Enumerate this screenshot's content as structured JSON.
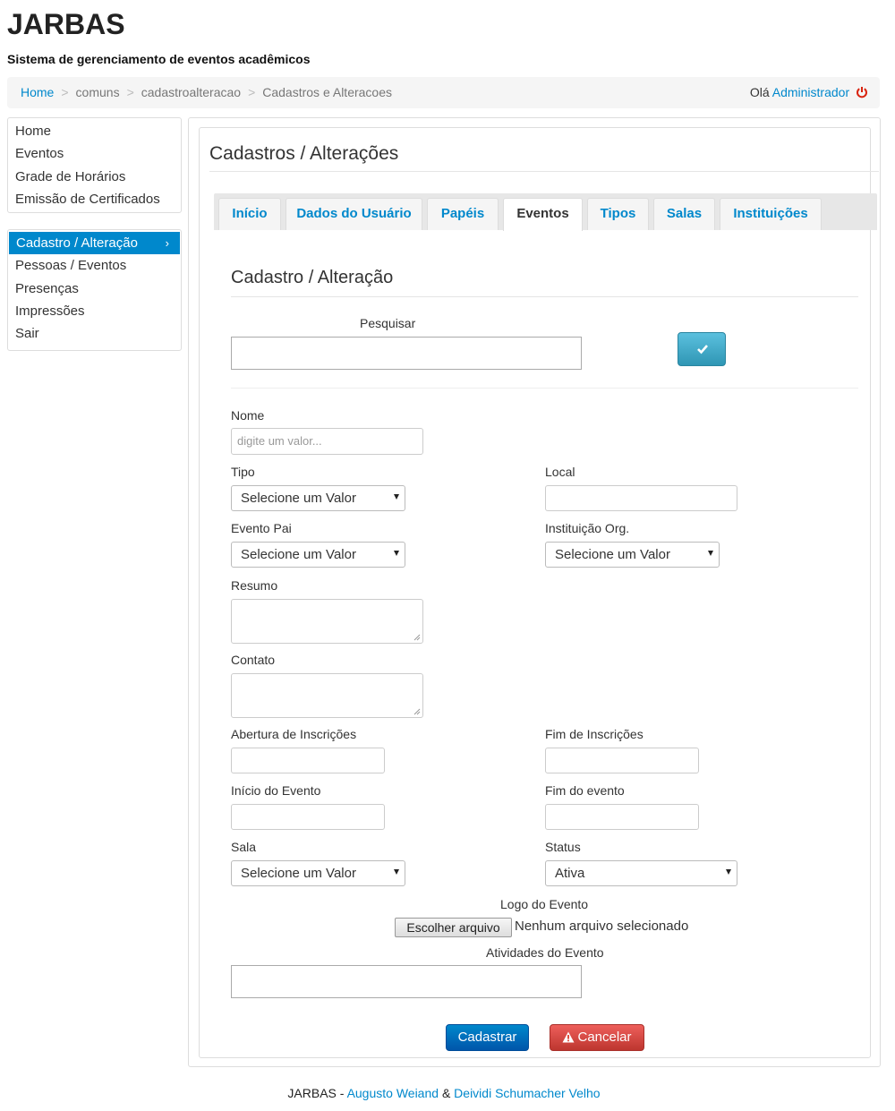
{
  "header": {
    "brand": "JARBAS",
    "tagline": "Sistema de gerenciamento de eventos acadêmicos"
  },
  "breadcrumb": {
    "items": [
      "Home",
      "comuns",
      "cadastroalteracao",
      "Cadastros e Alteracoes"
    ],
    "separator": ">"
  },
  "user": {
    "greeting": "Olá",
    "name": "Administrador",
    "logout_icon": "power-icon"
  },
  "sidebar": {
    "group1": [
      "Home",
      "Eventos",
      "Grade de Horários",
      "Emissão de Certificados"
    ],
    "group2": [
      "Cadastro / Alteração",
      "Pessoas / Eventos",
      "Presenças",
      "Impressões",
      "Sair"
    ],
    "active_item": "Cadastro / Alteração",
    "active_icon": "chevron-right-icon"
  },
  "page": {
    "title": "Cadastros / Alterações"
  },
  "tabs": [
    "Início",
    "Dados do Usuário",
    "Papéis",
    "Eventos",
    "Tipos",
    "Salas",
    "Instituições"
  ],
  "active_tab": "Eventos",
  "form": {
    "section_title": "Cadastro / Alteração",
    "search_label": "Pesquisar",
    "search_value": "",
    "search_button_icon": "check-icon",
    "nome_label": "Nome",
    "nome_placeholder": "digite um valor...",
    "tipo_label": "Tipo",
    "tipo_value": "Selecione um Valor",
    "local_label": "Local",
    "evento_pai_label": "Evento Pai",
    "evento_pai_value": "Selecione um Valor",
    "instituicao_label": "Instituição Org.",
    "instituicao_value": "Selecione um Valor",
    "resumo_label": "Resumo",
    "contato_label": "Contato",
    "abertura_label": "Abertura de Inscrições",
    "fim_inscricoes_label": "Fim de Inscrições",
    "inicio_evento_label": "Início do Evento",
    "fim_evento_label": "Fim do evento",
    "sala_label": "Sala",
    "sala_value": "Selecione um Valor",
    "status_label": "Status",
    "status_value": "Ativa",
    "logo_label": "Logo do Evento",
    "file_button": "Escolher arquivo",
    "file_status": "Nenhum arquivo selecionado",
    "atividades_label": "Atividades do Evento",
    "submit_label": "Cadastrar",
    "cancel_label": "Cancelar",
    "cancel_icon": "warning-icon"
  },
  "footer": {
    "brand": "JARBAS",
    "dash": "-",
    "author1": "Augusto Weiand",
    "amp": "&",
    "author2": "Deividi Schumacher Velho"
  },
  "colors": {
    "link": "#0088cc",
    "active_bg": "#0088cc",
    "primary": "#0055aa",
    "danger": "#d9230f",
    "info": "#2f96b4"
  }
}
